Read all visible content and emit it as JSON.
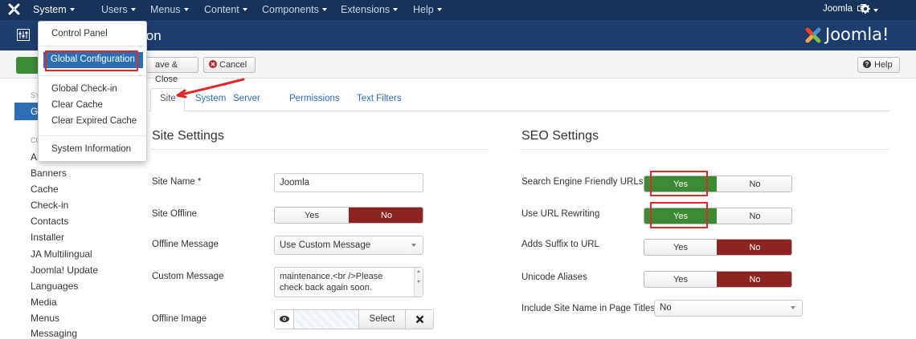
{
  "topbar": {
    "menus": [
      "System",
      "Users",
      "Menus",
      "Content",
      "Components",
      "Extensions",
      "Help"
    ],
    "user_label": "Joomla",
    "colors": {
      "bar": "#17325b",
      "header": "#1c3d6e",
      "accent": "#2d6fb5"
    }
  },
  "header": {
    "title_visible": "ion",
    "brand": "Joomla!"
  },
  "toolbar": {
    "save_close": "ave & Close",
    "cancel": "Cancel",
    "help": "Help"
  },
  "system_menu": {
    "items": [
      "Control Panel",
      "Global Configuration",
      "Global Check-in",
      "Clear Cache",
      "Clear Expired Cache",
      "System Information"
    ]
  },
  "sidebar": {
    "partial_heading_1": "SY",
    "partial_active": "G",
    "partial_heading_2": "CO",
    "partial_item": "A",
    "items": [
      "Banners",
      "Cache",
      "Check-in",
      "Contacts",
      "Installer",
      "JA Multilingual",
      "Joomla! Update",
      "Languages",
      "Media",
      "Menus",
      "Messaging"
    ]
  },
  "tabs": [
    "Site",
    "System",
    "Server",
    "Permissions",
    "Text Filters"
  ],
  "site_settings": {
    "title": "Site Settings",
    "site_name_label": "Site Name *",
    "site_name_value": "Joomla",
    "site_offline_label": "Site Offline",
    "offline_message_label": "Offline Message",
    "offline_message_value": "Use Custom Message",
    "custom_message_label": "Custom Message",
    "custom_message_line1": "maintenance.<br />Please",
    "custom_message_line2": "check back again soon.",
    "offline_image_label": "Offline Image",
    "select_label": "Select"
  },
  "seo_settings": {
    "title": "SEO Settings",
    "sef_label": "Search Engine Friendly URLs",
    "rewrite_label": "Use URL Rewriting",
    "suffix_label": "Adds Suffix to URL",
    "unicode_label": "Unicode Aliases",
    "sitename_titles_label": "Include Site Name in Page Titles",
    "sitename_titles_value": "No"
  },
  "toggle": {
    "yes": "Yes",
    "no": "No"
  }
}
